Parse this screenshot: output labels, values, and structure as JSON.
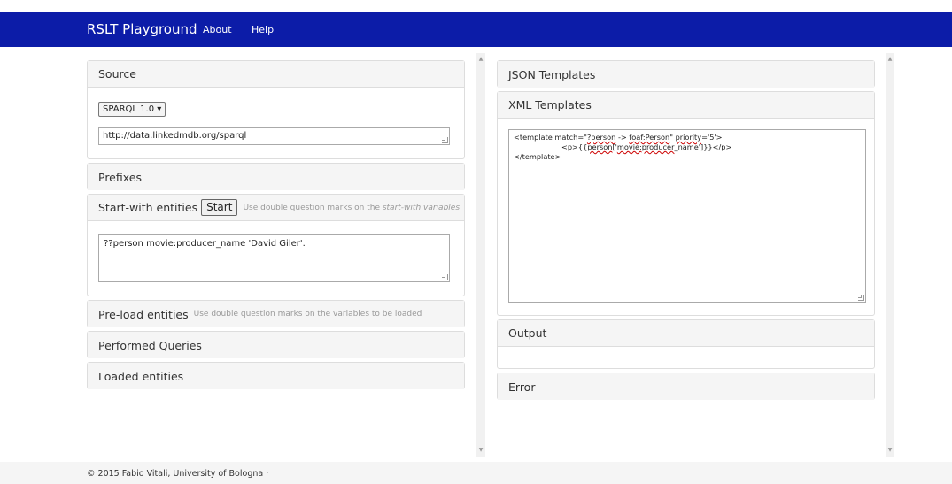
{
  "navbar": {
    "brand": "RSLT Playground",
    "links": [
      "About",
      "Help"
    ],
    "color": "#0c1ca8"
  },
  "left": {
    "source": {
      "title": "Source",
      "select_value": "SPARQL 1.0",
      "endpoint": "http://data.linkedmdb.org/sparql"
    },
    "prefixes": {
      "title": "Prefixes"
    },
    "start_with": {
      "title": "Start-with entities",
      "button": "Start",
      "hint_pre": "Use double question marks on the ",
      "hint_em": "start-with variables",
      "query": "??person movie:producer_name 'David Giler'."
    },
    "preload": {
      "title": "Pre-load entities",
      "hint": "Use double question marks on the variables to be loaded"
    },
    "performed": {
      "title": "Performed Queries"
    },
    "loaded": {
      "title": "Loaded entities"
    }
  },
  "right": {
    "json_templates": {
      "title": "JSON Templates"
    },
    "xml_templates": {
      "title": "XML Templates",
      "line1_a": "<template match=\"",
      "line1_b": "?person",
      "line1_c": " -> ",
      "line1_d": "foaf:Person",
      "line1_e": "\" ",
      "line1_f": "priority",
      "line1_g": "='5'>",
      "line2_a": "<p>{{",
      "line2_b": "person",
      "line2_c": "['",
      "line2_d": "movie:producer",
      "line2_e": "_name']}}</p>",
      "line3": "</template>"
    },
    "output": {
      "title": "Output"
    },
    "error": {
      "title": "Error"
    }
  },
  "footer": {
    "text": "© 2015 Fabio Vitali, University of Bologna ·"
  },
  "icons": {
    "select_arrow": "▾",
    "scroll_up": "▲",
    "scroll_down": "▼"
  }
}
